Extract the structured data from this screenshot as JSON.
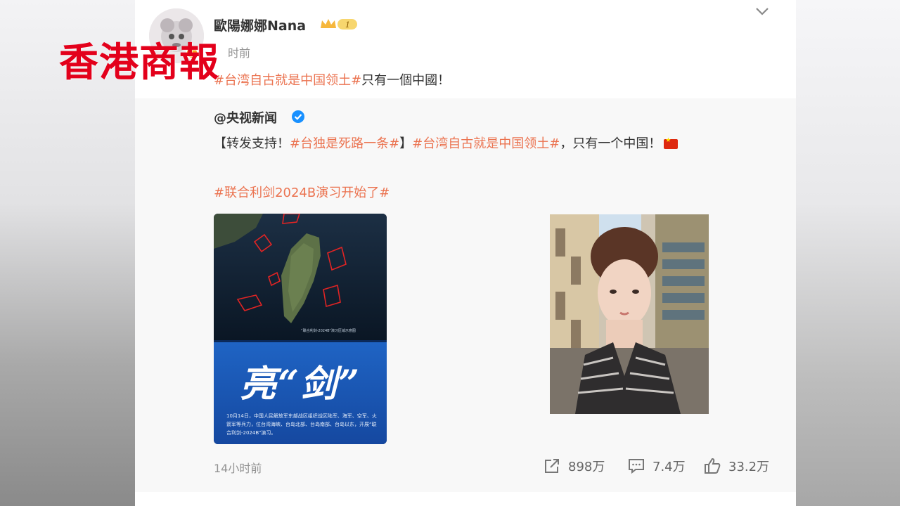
{
  "author": {
    "name": "歐陽娜娜Nana",
    "vip_level": "1",
    "time_partial": "时前"
  },
  "post": {
    "tag": "#台湾自古就是中国领土#",
    "text": "只有一個中國！"
  },
  "repost": {
    "author": "@央视新闻",
    "open_bracket": "【转发支持！",
    "tag1": "#台独是死路一条#",
    "close_bracket": "】",
    "tag2": "#台湾自古就是中国领土#",
    "tail": "，只有一个中国！",
    "tag3": "#联合利剑2024B演习开始了#",
    "map_caption": "“联合利剑-2024B”演习区域示意图",
    "banner_title": "亮“剑”",
    "banner_desc": "10月14日，中国人民解放军东部战区组织战区陆军、海军、空军、火箭军等兵力，位台湾海峡、台岛北部、台岛南部、台岛以东，开展“联合利剑-2024B”演习。"
  },
  "footer": {
    "time": "14小时前",
    "shares": "898万",
    "comments": "7.4万",
    "likes": "33.2万"
  },
  "watermark": "香港商報",
  "colors": {
    "tag": "#eb7350",
    "watermark": "#e3001b",
    "background": "#ffffff",
    "repost_bg": "#f8f8f8"
  },
  "icons": [
    "chevron-down-icon",
    "vip-crown-icon",
    "verified-icon",
    "china-flag-icon",
    "share-icon",
    "comment-icon",
    "like-icon"
  ]
}
